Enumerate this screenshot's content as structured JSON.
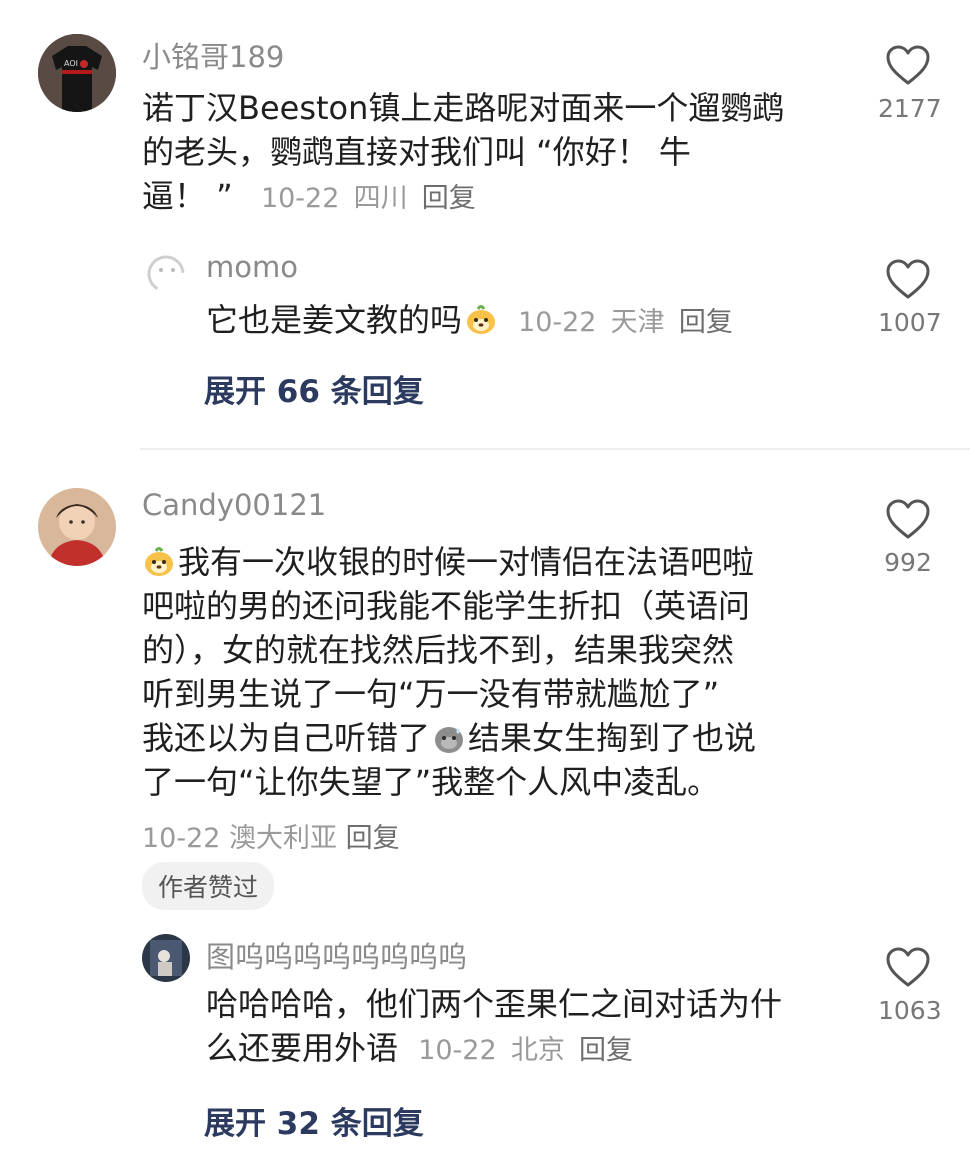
{
  "comments": [
    {
      "username": "小铭哥189",
      "text": "诺丁汉Beeston镇上走路呢对面来一个遛鹦鹉的老头，鹦鹉直接对我们叫 “你好！ 牛逼！ ”",
      "text_line1": "诺丁汉Beeston镇上走路呢对面来一个遛鹦鹉",
      "text_line2": "的老头，鹦鹉直接对我们叫 “你好！ 牛",
      "text_line3": "逼！ ”",
      "date": "10-22",
      "location": "四川",
      "reply_label": "回复",
      "likes": "2177",
      "replies": [
        {
          "username": "momo",
          "text": "它也是姜文教的吗",
          "date": "10-22",
          "location": "天津",
          "reply_label": "回复",
          "likes": "1007"
        }
      ],
      "expand_label": "展开 66 条回复"
    },
    {
      "username": "Candy00121",
      "text_line1": "我有一次收银的时候一对情侣在法语吧啦",
      "text_line2": "吧啦的男的还问我能不能学生折扣（英语问",
      "text_line3": "的），女的就在找然后找不到，结果我突然",
      "text_line4": "听到男生说了一句“万一没有带就尴尬了”",
      "text_line5a": "我还以为自己听错了",
      "text_line5b": "结果女生掏到了也说",
      "text_line6": "了一句“让你失望了”我整个人风中凌乱。",
      "date": "10-22",
      "location": "澳大利亚",
      "reply_label": "回复",
      "author_badge": "作者赞过",
      "likes": "992",
      "replies": [
        {
          "username": "图呜呜呜呜呜呜呜呜",
          "text_line1": "哈哈哈哈，他们两个歪果仁之间对话为什",
          "text_line2": "么还要用外语",
          "date": "10-22",
          "location": "北京",
          "reply_label": "回复",
          "likes": "1063"
        }
      ],
      "expand_label": "展开 32 条回复"
    }
  ]
}
